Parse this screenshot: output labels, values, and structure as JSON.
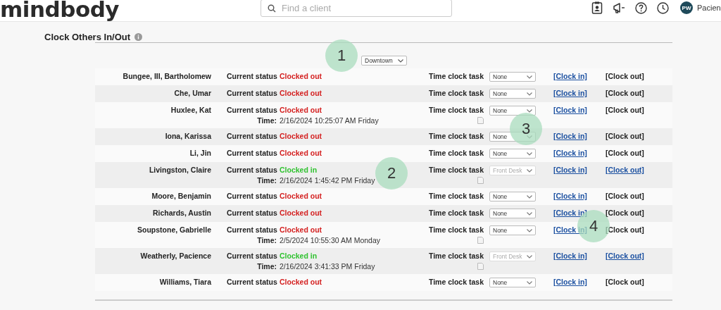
{
  "header": {
    "logo": "mindbody",
    "search": {
      "placeholder": "Find a client"
    },
    "avatar": "PW",
    "user": "Pacien"
  },
  "page": {
    "title": "Clock Others In/Out",
    "location": "Downtown"
  },
  "rows": [
    {
      "name": "Bungee, III, Bartholomew",
      "status_label": "Current status",
      "status": "Clocked out",
      "clocked_in": false,
      "task_label": "Time clock task",
      "task": "None",
      "task_disabled": false,
      "clock_in": "[Clock in]",
      "clock_out": "[Clock out]",
      "clock_out_link": false
    },
    {
      "name": "Che, Umar",
      "status_label": "Current status",
      "status": "Clocked out",
      "clocked_in": false,
      "task_label": "Time clock task",
      "task": "None",
      "task_disabled": false,
      "clock_in": "[Clock in]",
      "clock_out": "[Clock out]",
      "clock_out_link": false
    },
    {
      "name": "Huxlee, Kat",
      "status_label": "Current status",
      "status": "Clocked out",
      "clocked_in": false,
      "time_label": "Time:",
      "time": "2/16/2024 10:25:07 AM Friday",
      "note": true,
      "task_label": "Time clock task",
      "task": "None",
      "task_disabled": false,
      "clock_in": "[Clock in]",
      "clock_out": "[Clock out]",
      "clock_out_link": false
    },
    {
      "name": "Iona, Karissa",
      "status_label": "Current status",
      "status": "Clocked out",
      "clocked_in": false,
      "task_label": "Time clock task",
      "task": "None",
      "task_disabled": false,
      "clock_in": "[Clock in]",
      "clock_out": "[Clock out]",
      "clock_out_link": false
    },
    {
      "name": "Li, Jin",
      "status_label": "Current status",
      "status": "Clocked out",
      "clocked_in": false,
      "task_label": "Time clock task",
      "task": "None",
      "task_disabled": false,
      "clock_in": "[Clock in]",
      "clock_out": "[Clock out]",
      "clock_out_link": false
    },
    {
      "name": "Livingston, Claire",
      "status_label": "Current status",
      "status": "Clocked in",
      "clocked_in": true,
      "time_label": "Time:",
      "time": "2/16/2024 1:45:42 PM Friday",
      "note": true,
      "task_label": "Time clock task",
      "task": "Front Desk",
      "task_disabled": true,
      "clock_in": "[Clock in]",
      "clock_out": "[Clock out]",
      "clock_out_link": true
    },
    {
      "name": "Moore, Benjamin",
      "status_label": "Current status",
      "status": "Clocked out",
      "clocked_in": false,
      "task_label": "Time clock task",
      "task": "None",
      "task_disabled": false,
      "clock_in": "[Clock in]",
      "clock_out": "[Clock out]",
      "clock_out_link": false
    },
    {
      "name": "Richards, Austin",
      "status_label": "Current status",
      "status": "Clocked out",
      "clocked_in": false,
      "task_label": "Time clock task",
      "task": "None",
      "task_disabled": false,
      "clock_in": "[Clock in]",
      "clock_out": "[Clock out]",
      "clock_out_link": false
    },
    {
      "name": "Soupstone, Gabrielle",
      "status_label": "Current status",
      "status": "Clocked out",
      "clocked_in": false,
      "time_label": "Time:",
      "time": "2/5/2024 10:55:30 AM Monday",
      "note": true,
      "task_label": "Time clock task",
      "task": "None",
      "task_disabled": false,
      "clock_in": "[Clock in]",
      "clock_out": "[Clock out]",
      "clock_out_link": false
    },
    {
      "name": "Weatherly, Pacience",
      "status_label": "Current status",
      "status": "Clocked in",
      "clocked_in": true,
      "time_label": "Time:",
      "time": "2/16/2024 3:41:33 PM Friday",
      "note": true,
      "task_label": "Time clock task",
      "task": "Front Desk",
      "task_disabled": true,
      "clock_in": "[Clock in]",
      "clock_out": "[Clock out]",
      "clock_out_link": true
    },
    {
      "name": "Williams, Tiara",
      "status_label": "Current status",
      "status": "Clocked out",
      "clocked_in": false,
      "task_label": "Time clock task",
      "task": "None",
      "task_disabled": false,
      "clock_in": "[Clock in]",
      "clock_out": "[Clock out]",
      "clock_out_link": false
    }
  ],
  "callouts": [
    "1",
    "2",
    "3",
    "4"
  ]
}
